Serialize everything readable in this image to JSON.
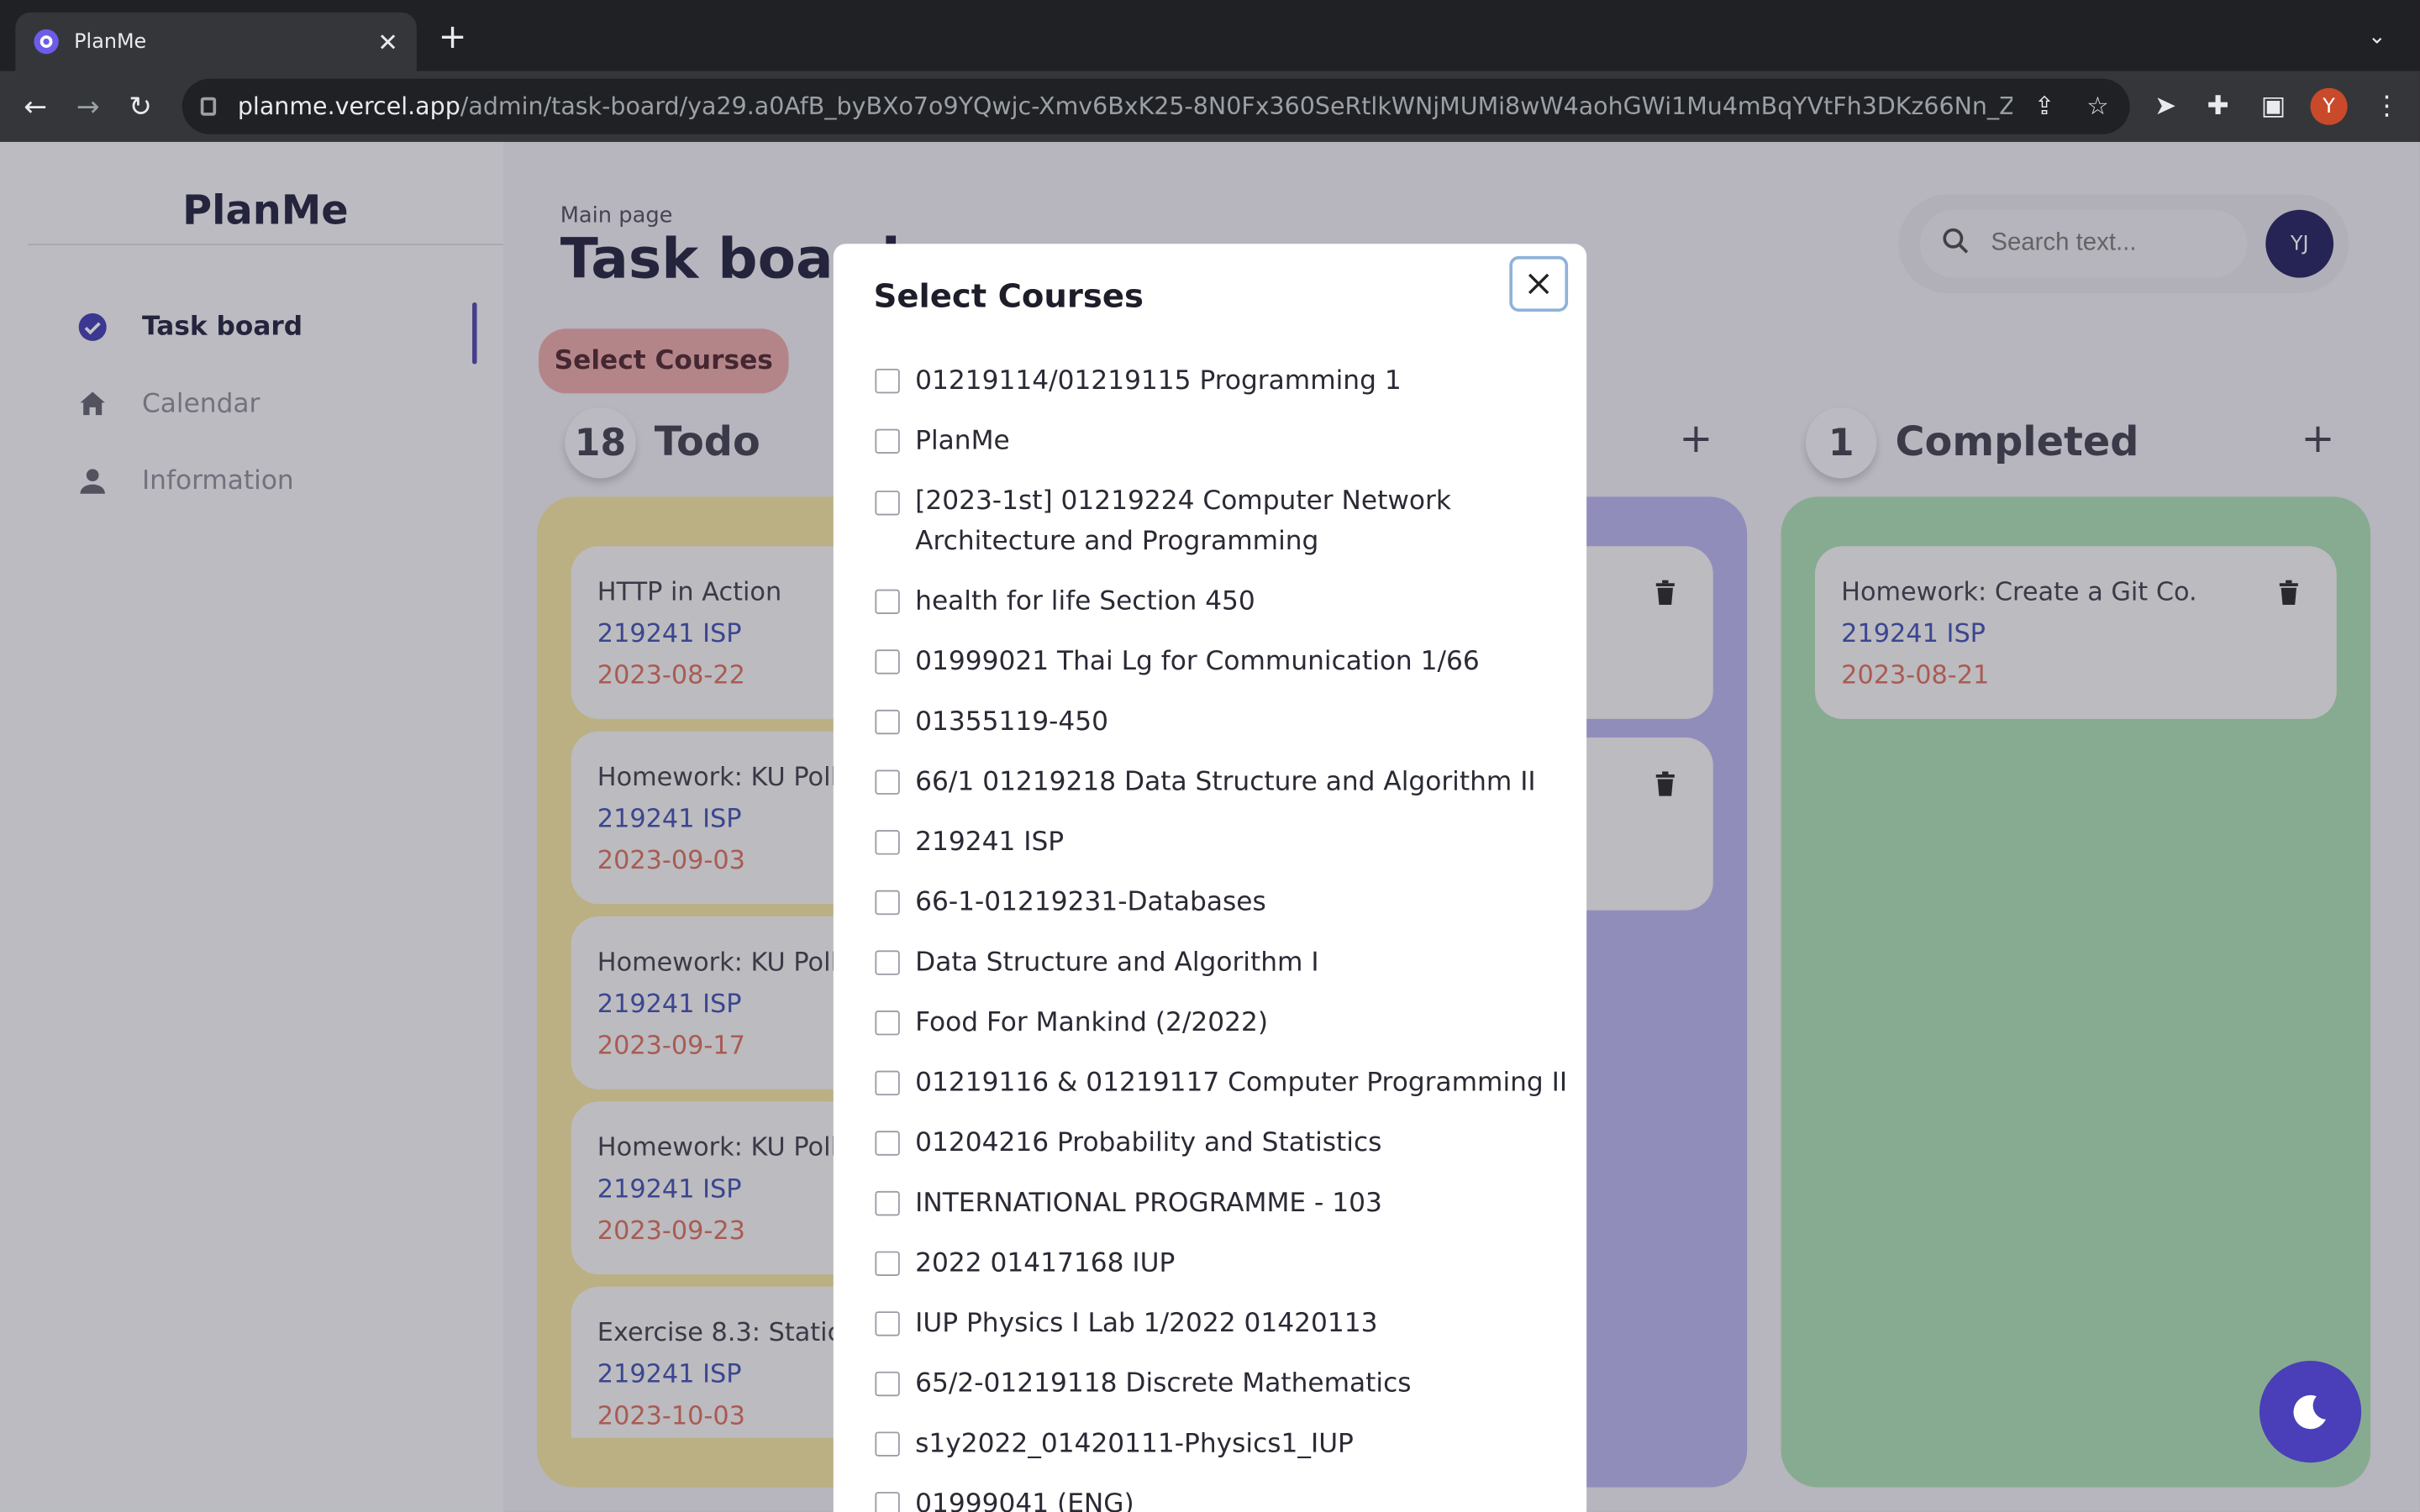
{
  "browser": {
    "tab_title": "PlanMe",
    "url_host": "planme.vercel.app",
    "url_path": "/admin/task-board/ya29.a0AfB_byBXo7o9YQwjc-Xmv6BxK25-8N0Fx360SeRtlkWNjMUMi8wW4aohGWi1Mu4mBqYVtFh3DKz66Nn_ZarQi_B...",
    "profile_initial": "Y"
  },
  "sidebar": {
    "logo": "PlanMe",
    "items": [
      {
        "label": "Task board",
        "icon": "check-circle-icon"
      },
      {
        "label": "Calendar",
        "icon": "home-icon"
      },
      {
        "label": "Information",
        "icon": "person-icon"
      }
    ]
  },
  "header": {
    "breadcrumb": "Main page",
    "title": "Task board",
    "select_courses_label": "Select Courses",
    "search_placeholder": "Search text...",
    "avatar_initials": "YJ"
  },
  "columns": {
    "todo": {
      "count": "18",
      "title": "Todo",
      "cards": [
        {
          "title": "HTTP in Action",
          "course": "219241 ISP",
          "date": "2023-08-22"
        },
        {
          "title": "Homework: KU Polls",
          "course": "219241 ISP",
          "date": "2023-09-03"
        },
        {
          "title": "Homework: KU Polls",
          "course": "219241 ISP",
          "date": "2023-09-17"
        },
        {
          "title": "Homework: KU Polls",
          "course": "219241 ISP",
          "date": "2023-09-23"
        },
        {
          "title": "Exercise 8.3: Static T",
          "course": "219241 ISP",
          "date": "2023-10-03"
        }
      ]
    },
    "completed": {
      "count": "1",
      "title": "Completed",
      "cards": [
        {
          "title": "Homework: Create a Git Co...",
          "course": "219241 ISP",
          "date": "2023-08-21"
        }
      ]
    }
  },
  "modal": {
    "title": "Select Courses",
    "courses": [
      "01219114/01219115 Programming 1",
      "PlanMe",
      "[2023-1st] 01219224 Computer Network Architecture and Programming",
      "health for life Section 450",
      "01999021 Thai Lg for Communication 1/66",
      "01355119-450",
      "66/1 01219218 Data Structure and Algorithm II",
      "219241 ISP",
      "66-1-01219231-Databases",
      "Data Structure and Algorithm I",
      "Food For Mankind (2/2022)",
      "01219116 & 01219117 Computer Programming II",
      "01204216 Probability and Statistics",
      "INTERNATIONAL PROGRAMME - 103",
      "2022 01417168 IUP",
      "IUP Physics I Lab 1/2022 01420113",
      "65/2-01219118 Discrete Mathematics",
      "s1y2022_01420111-Physics1_IUP",
      "01999041 (ENG)"
    ]
  },
  "colors": {
    "todo_column": "#f2e3a0",
    "middle_column": "#b7b0ee",
    "completed_column": "#a8dcb0",
    "accent": "#4b3fa8"
  }
}
